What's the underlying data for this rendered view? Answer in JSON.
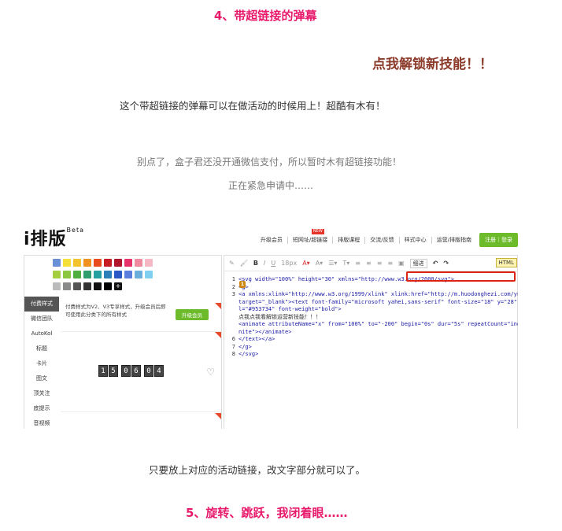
{
  "heading4": "4、带超链接的弹幕",
  "cta": "点我解锁新技能！！",
  "para1": "这个带超链接的弹幕可以在做活动的时候用上！超酷有木有！",
  "para2": "别点了，盒子君还没开通微信支付，所以暂时木有超链接功能！",
  "para3": "正在紧急申请中……",
  "screenshot": {
    "logo": "i排版",
    "logo_sup": "Beta",
    "new_badge": "NEW",
    "nav": [
      "升级会员",
      "短网址/超链接",
      "排版课程",
      "交流/反馈",
      "样式中心",
      "运营/排版指南"
    ],
    "login": "注册｜登录",
    "swatch_colors": [
      [
        "#6b8fd6",
        "#f5e03a",
        "#f4c430",
        "#f0921f",
        "#e84c1e",
        "#c81d25",
        "#b0152b",
        "#e6336b",
        "#f08aa0",
        "#f6b8c4"
      ],
      [
        "#a6cf3f",
        "#8dc63f",
        "#4fae3f",
        "#2e9e6e",
        "#25a0a0",
        "#2c7fb8",
        "#2b58c6",
        "#5b7fdc",
        "#6aaedc",
        "#7fd0f0"
      ],
      [
        "#bbbbbb",
        "#8a8a8a",
        "#555555",
        "#333333",
        "#111111",
        "#000000"
      ]
    ],
    "side_nav": [
      "付费样式",
      "微信团队",
      "AutoKol",
      "标题",
      "卡片",
      "图文",
      "顶关注",
      "底提示",
      "音视频"
    ],
    "promo_line1": "付费样式为V2、V3专享样式，升级会员后即",
    "promo_line2": "可使用此分类下的所有样式",
    "promo_button": "升级会员",
    "counter_digits": [
      "1",
      "5",
      "0",
      "6",
      "0",
      "4"
    ],
    "toolbar": {
      "bold": "B",
      "italic": "I",
      "underline": "U",
      "font_size": "18px",
      "cut_label": "细进",
      "html_label": "HTML"
    },
    "code_lines": [
      {
        "n": "1",
        "text": "<svg width=\"100%\" height=\"30\" xmlns=\"http://www.w3.org/2000/svg\">"
      },
      {
        "n": "2",
        "text": "  <g>"
      },
      {
        "n": "3",
        "text": "    <a xmlns:xlink=\"http://www.w3.org/1999/xlink\" xlink:href=\"http://m.huodonghezi.com/yunyin"
      },
      {
        "n": "",
        "text": "    target=\"_blank\"><text font-family=\"microsoft yahei,sans-serif\" font-size=\"18\" y=\"28\" x=\"-36.1786\" fi"
      },
      {
        "n": "",
        "text": "  l=\"#953734\" font-weight=\"bold\">"
      },
      {
        "n": "",
        "text": "        点我点我看解锁运营新技能！！！"
      },
      {
        "n": "",
        "text": "      <animate attributeName=\"x\" from=\"100%\" to=\"-200\" begin=\"0s\" dur=\"5s\" repeatCount=\"indefi"
      },
      {
        "n": "",
        "text": "  nite\"></animate>"
      },
      {
        "n": "6",
        "text": "    </text></a>"
      },
      {
        "n": "7",
        "text": "  </g>"
      },
      {
        "n": "8",
        "text": "</svg>"
      }
    ],
    "badge_num": "1"
  },
  "para4": "只要放上对应的活动链接，改文字部分就可以了。",
  "heading5": "5、旋转、跳跃，我闭着眼……"
}
